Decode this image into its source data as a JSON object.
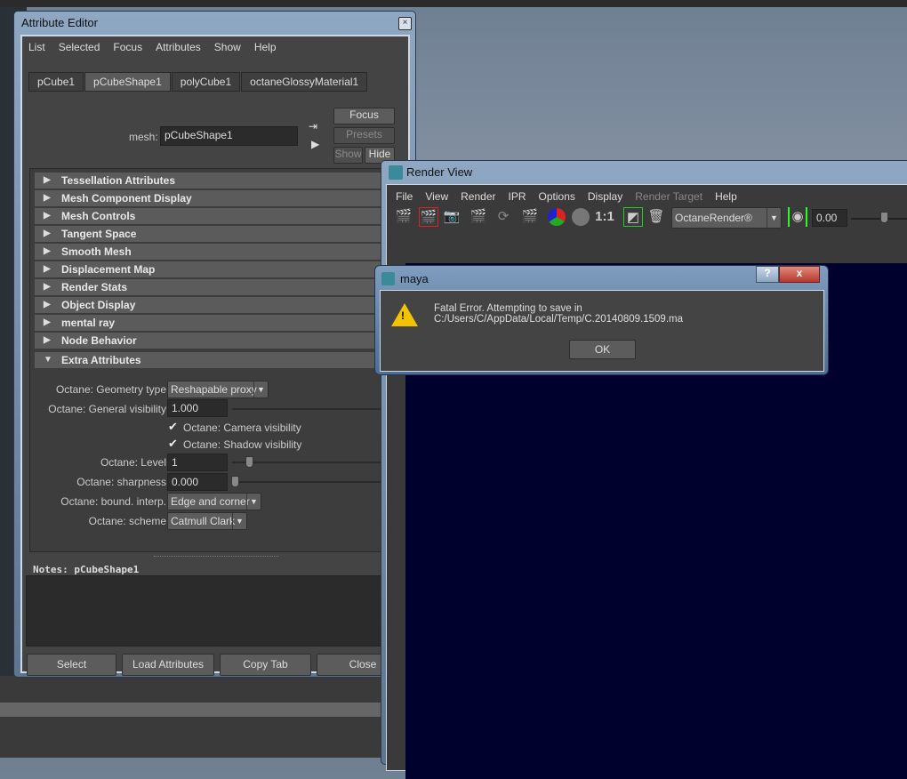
{
  "attribute_editor": {
    "title": "Attribute Editor",
    "menu": [
      "List",
      "Selected",
      "Focus",
      "Attributes",
      "Show",
      "Help"
    ],
    "tabs": [
      {
        "label": "pCube1"
      },
      {
        "label": "pCubeShape1",
        "active": true
      },
      {
        "label": "polyCube1"
      },
      {
        "label": "octaneGlossyMaterial1"
      }
    ],
    "mesh_label": "mesh:",
    "mesh_value": "pCubeShape1",
    "focus": "Focus",
    "presets": "Presets",
    "show": "Show",
    "hide": "Hide",
    "sections": [
      "Tessellation Attributes",
      "Mesh Component Display",
      "Mesh Controls",
      "Tangent Space",
      "Smooth Mesh",
      "Displacement Map",
      "Render Stats",
      "Object Display",
      "mental ray",
      "Node Behavior"
    ],
    "extra_section": "Extra Attributes",
    "extra": {
      "geometry_type_label": "Octane: Geometry type",
      "geometry_type": "Reshapable proxy",
      "general_visibility_label": "Octane: General visibility",
      "general_visibility": "1.000",
      "camera_visibility": "Octane: Camera visibility",
      "shadow_visibility": "Octane: Shadow visibility",
      "level_label": "Octane: Level",
      "level": "1",
      "sharpness_label": "Octane: sharpness",
      "sharpness": "0.000",
      "bound_interp_label": "Octane: bound. interp.",
      "bound_interp": "Edge and corner",
      "scheme_label": "Octane: scheme",
      "scheme": "Catmull Clark"
    },
    "notes": "Notes:  pCubeShape1",
    "buttons": [
      "Select",
      "Load Attributes",
      "Copy Tab",
      "Close"
    ]
  },
  "render_view": {
    "title": "Render View",
    "menu": [
      "File",
      "View",
      "Render",
      "IPR",
      "Options",
      "Display",
      "Render Target",
      "Help"
    ],
    "ratio": "1:1",
    "renderer": "OctaneRender®",
    "exposure": "0.00"
  },
  "dialog": {
    "title": "maya",
    "message": "Fatal Error. Attempting to save in C:/Users/C/AppData/Local/Temp/C.20140809.1509.ma",
    "ok": "OK",
    "help": "?",
    "close": "x"
  }
}
